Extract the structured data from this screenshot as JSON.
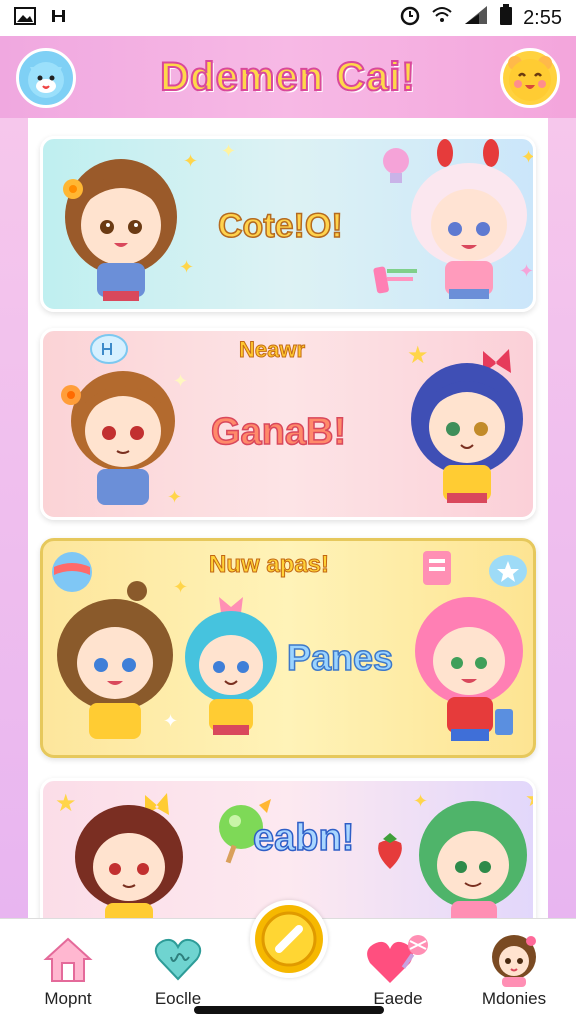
{
  "status_bar": {
    "time": "2:55"
  },
  "header": {
    "title": "Ddemen Cai!"
  },
  "cards": [
    {
      "title": "Cote!O!"
    },
    {
      "subtitle": "Neawr",
      "title": "GanaB!"
    },
    {
      "subtitle": "Nuw apas!",
      "title": "Panes"
    },
    {
      "title": "eabn!"
    }
  ],
  "nav": {
    "items": [
      {
        "label": "Mopnt",
        "icon": "home-icon"
      },
      {
        "label": "Eoclle",
        "icon": "heart-icon"
      },
      {
        "label": "",
        "icon": "coin-icon"
      },
      {
        "label": "Eaede",
        "icon": "heart-lollipop-icon"
      },
      {
        "label": "Mdonies",
        "icon": "avatar-icon"
      }
    ]
  },
  "colors": {
    "header": "#f3a9df",
    "accent": "#d9489b",
    "coin": "#f6b800"
  }
}
